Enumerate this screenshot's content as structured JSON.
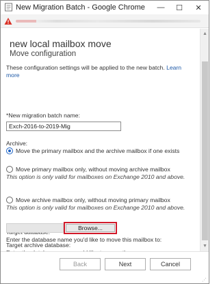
{
  "window": {
    "title": "New Migration Batch - Google Chrome",
    "controls": {
      "minimize": "—",
      "maximize": "☐",
      "close": "✕"
    }
  },
  "page": {
    "heading": "new local mailbox move",
    "subheading": "Move configuration",
    "intro_text": "These configuration settings will be applied to the new batch.",
    "learn_more": "Learn more",
    "batch_name_label": "*New migration batch name:",
    "batch_name_value": "Exch-2016-to-2019-Mig",
    "archive_label": "Archive:",
    "options": [
      {
        "label": "Move the primary mailbox and the archive mailbox if one exists",
        "note": "",
        "selected": true
      },
      {
        "label": "Move primary mailbox only, without moving archive mailbox",
        "note": "This option is only valid for mailboxes on Exchange 2010 and above.",
        "selected": false
      },
      {
        "label": "Move archive mailbox only, without moving primary mailbox",
        "note": "This option is only valid for mailboxes on Exchange 2010 and above.",
        "selected": false
      }
    ],
    "target_db_label": "Target database:",
    "target_db_desc": "Enter the database name you'd like to move this mailbox to:",
    "browse_label": "Browse...",
    "target_archive_label": "Target archive database:",
    "target_archive_desc": "Enter the database name you'd like to move the"
  },
  "footer": {
    "back": "Back",
    "next": "Next",
    "cancel": "Cancel"
  },
  "colors": {
    "link": "#1f5aa8",
    "highlight": "#d11a2a",
    "radio_selected": "#1c62c4"
  }
}
